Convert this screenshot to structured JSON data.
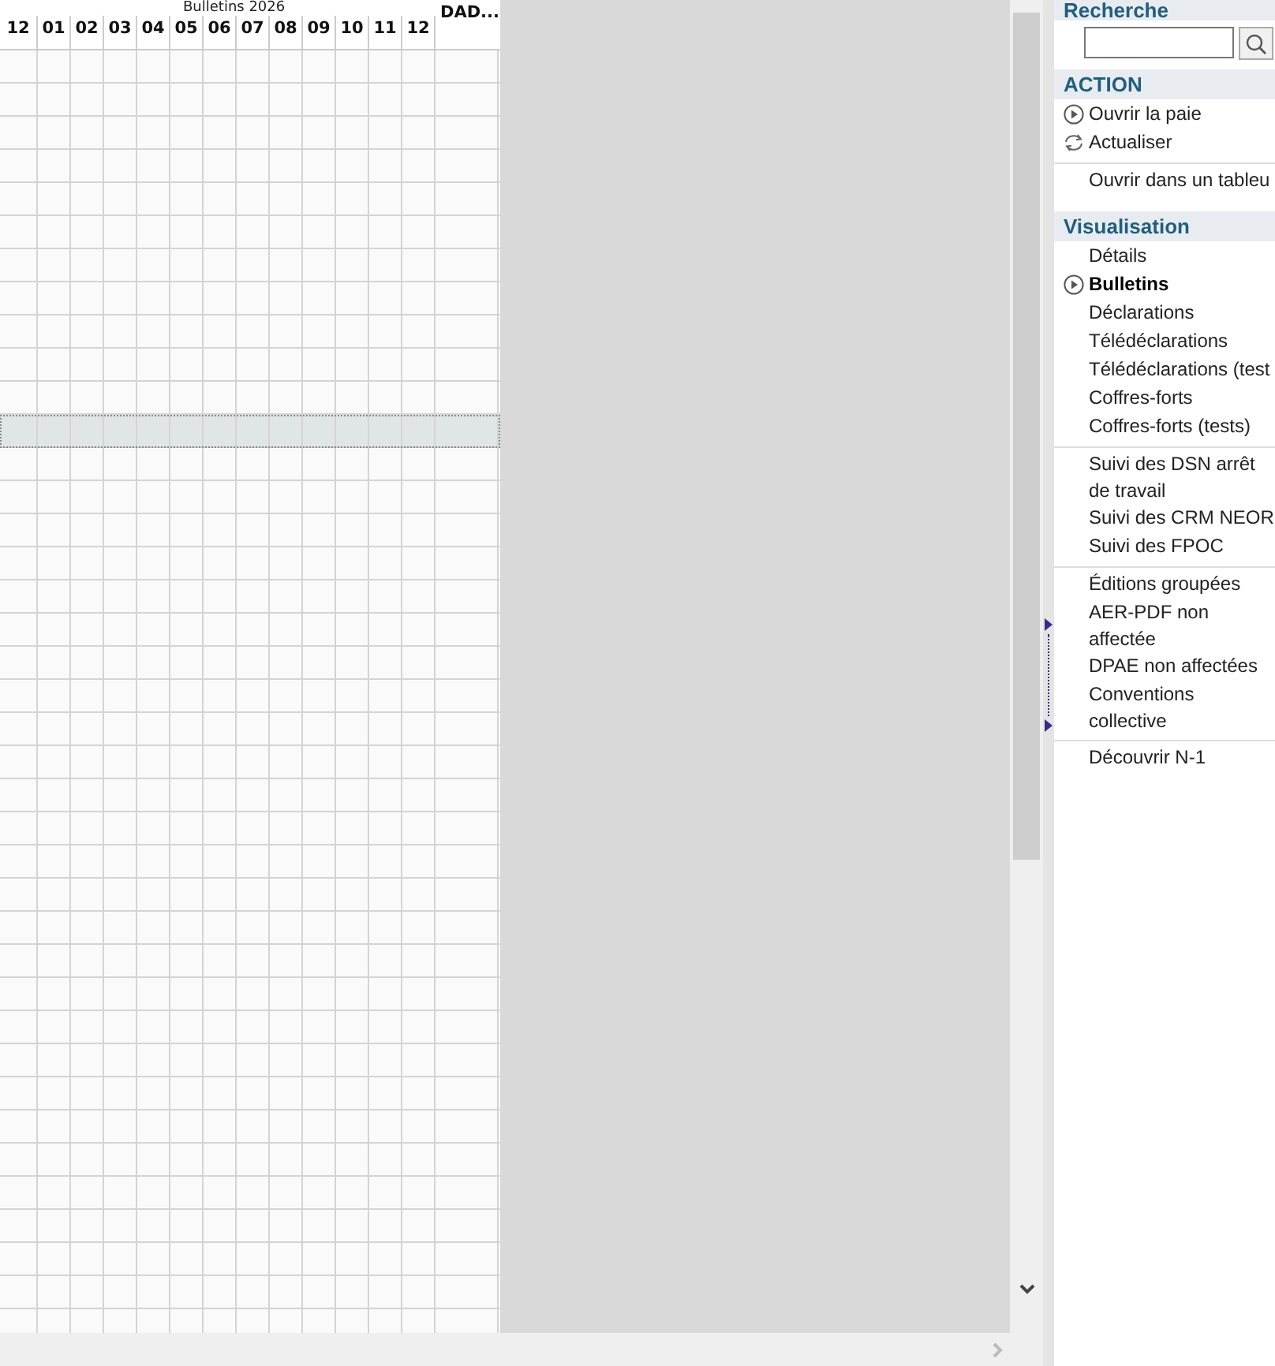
{
  "table": {
    "group_title": "Bulletins 2026",
    "columns": [
      "12",
      "01",
      "02",
      "03",
      "04",
      "05",
      "06",
      "07",
      "08",
      "09",
      "10",
      "11",
      "12",
      "DAD..."
    ],
    "rows": [
      {
        "selected": false
      },
      {
        "selected": false
      },
      {
        "selected": false
      },
      {
        "selected": false
      },
      {
        "selected": false
      },
      {
        "selected": false
      },
      {
        "selected": false
      },
      {
        "selected": false
      },
      {
        "selected": false
      },
      {
        "selected": false
      },
      {
        "selected": false
      },
      {
        "selected": true
      },
      {
        "selected": false
      },
      {
        "selected": false
      },
      {
        "selected": false
      },
      {
        "selected": false
      },
      {
        "selected": false
      },
      {
        "selected": false
      },
      {
        "selected": false
      },
      {
        "selected": false
      },
      {
        "selected": false
      },
      {
        "selected": false
      },
      {
        "selected": false
      },
      {
        "selected": false
      },
      {
        "selected": false
      },
      {
        "selected": false
      },
      {
        "selected": false
      },
      {
        "selected": false
      },
      {
        "selected": false
      },
      {
        "selected": false
      },
      {
        "selected": false
      },
      {
        "selected": false
      },
      {
        "selected": false
      },
      {
        "selected": false
      },
      {
        "selected": false
      },
      {
        "selected": false
      },
      {
        "selected": false
      },
      {
        "selected": false
      },
      {
        "selected": false
      }
    ]
  },
  "sidebar": {
    "search": {
      "title": "Recherche"
    },
    "action": {
      "title": "ACTION",
      "groups": [
        [
          {
            "label": "Ouvrir la paie",
            "kind": "play"
          },
          {
            "label": "Actualiser",
            "kind": "refresh"
          }
        ],
        [
          {
            "label": "Ouvrir dans un tableu",
            "kind": "plain"
          }
        ]
      ]
    },
    "view": {
      "title": "Visualisation",
      "groups": [
        [
          {
            "label": "Détails",
            "selected": false
          },
          {
            "label": "Bulletins",
            "selected": true
          },
          {
            "label": "Déclarations",
            "selected": false
          },
          {
            "label": "Télédéclarations",
            "selected": false
          },
          {
            "label": "Télédéclarations (test",
            "selected": false
          },
          {
            "label": "Coffres-forts",
            "selected": false
          },
          {
            "label": "Coffres-forts (tests)",
            "selected": false
          }
        ],
        [
          {
            "label": "Suivi des DSN arrêt de travail",
            "selected": false
          },
          {
            "label": "Suivi des CRM NEOR",
            "selected": false
          },
          {
            "label": "Suivi des FPOC",
            "selected": false
          }
        ],
        [
          {
            "label": "Éditions groupées",
            "selected": false
          },
          {
            "label": "AER-PDF non affectée",
            "selected": false
          },
          {
            "label": "DPAE non affectées",
            "selected": false
          },
          {
            "label": "Conventions collective",
            "selected": false
          }
        ],
        [
          {
            "label": "Découvrir N-1",
            "selected": false
          }
        ]
      ]
    }
  }
}
